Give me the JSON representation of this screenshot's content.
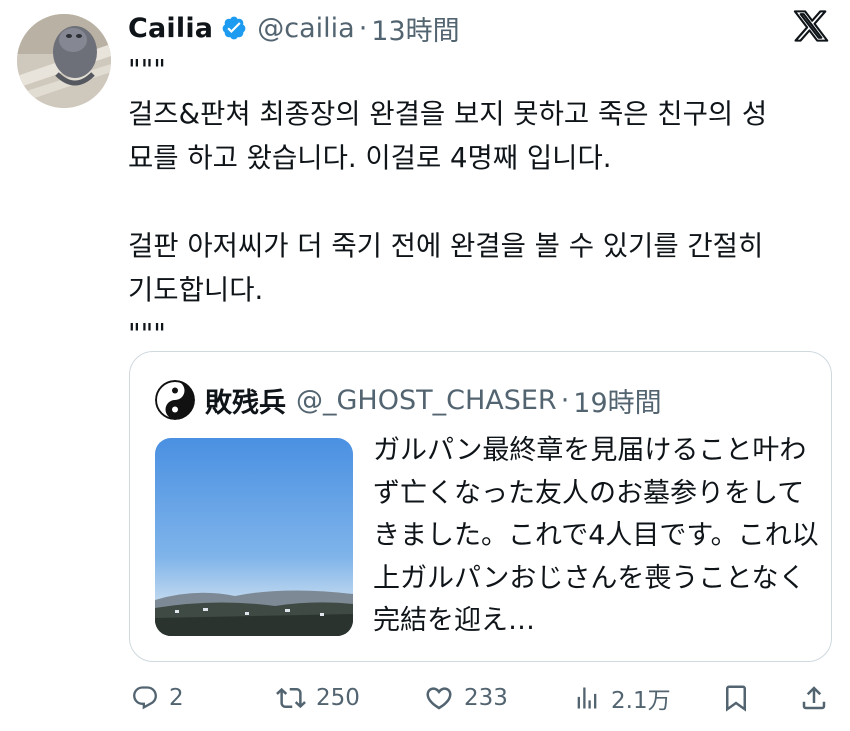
{
  "author": {
    "display_name": "Cailia",
    "handle": "@cailia",
    "separator": "·",
    "time": "13時間"
  },
  "tweet": {
    "text": "\"\"\"\n걸즈&판쳐 최종장의 완결을 보지 못하고 죽은 친구의 성\n묘를 하고 왔습니다. 이걸로 4명째 입니다.\n\n걸판 아저씨가 더 죽기 전에 완결을 볼 수 있기를 간절히\n기도합니다.\n\"\"\""
  },
  "quote": {
    "display_name": "敗残兵",
    "handle": "@_GHOST_CHASER",
    "separator": "·",
    "time": "19時間",
    "text": "ガルパン最終章を見届けること叶わず亡くなった友人のお墓参りをしてきました。これで4人目です。これ以上ガルパンおじさんを喪うことなく完結を迎え…"
  },
  "actions": {
    "replies": "2",
    "reposts": "250",
    "likes": "233",
    "views": "2.1万"
  },
  "icons": {
    "verified": "verified-badge-icon",
    "logo": "x-logo-icon",
    "reply": "reply-icon",
    "repost": "repost-icon",
    "like": "heart-icon",
    "views": "views-chart-icon",
    "bookmark": "bookmark-icon",
    "share": "share-icon"
  },
  "colors": {
    "verified_blue": "#1d9bf0",
    "secondary_text": "#536471",
    "border": "#cfd9de"
  }
}
